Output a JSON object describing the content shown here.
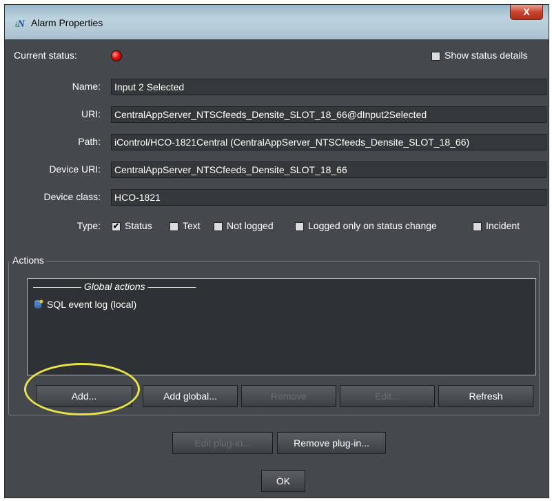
{
  "window": {
    "title": "Alarm Properties",
    "close_label": "X",
    "app_icon_label": "iN"
  },
  "status": {
    "label": "Current status:",
    "details_label": "Show status details",
    "details_checked": false
  },
  "fields": {
    "name": {
      "label": "Name:",
      "value": "Input 2 Selected"
    },
    "uri": {
      "label": "URI:",
      "value": "CentralAppServer_NTSCfeeds_Densite_SLOT_18_66@dInput2Selected"
    },
    "path": {
      "label": "Path:",
      "value": "iControl/HCO-1821Central (CentralAppServer_NTSCfeeds_Densite_SLOT_18_66)"
    },
    "device_uri": {
      "label": "Device URI:",
      "value": "CentralAppServer_NTSCfeeds_Densite_SLOT_18_66"
    },
    "device_class": {
      "label": "Device class:",
      "value": "HCO-1821"
    }
  },
  "type": {
    "label": "Type:",
    "options": [
      {
        "label": "Status",
        "checked": true
      },
      {
        "label": "Text",
        "checked": false
      },
      {
        "label": "Not logged",
        "checked": false
      },
      {
        "label": "Logged only on status change",
        "checked": false
      },
      {
        "label": "Incident",
        "checked": false
      }
    ]
  },
  "actions": {
    "group_label": "Actions",
    "list_heading": "————— Global actions —————",
    "items": [
      {
        "label": "SQL event log (local)"
      }
    ],
    "buttons": {
      "add": "Add...",
      "add_global": "Add global...",
      "remove": "Remove",
      "edit": "Edit...",
      "refresh": "Refresh"
    }
  },
  "plugin": {
    "edit": "Edit plug-in...",
    "remove": "Remove plug-in..."
  },
  "ok_label": "OK"
}
